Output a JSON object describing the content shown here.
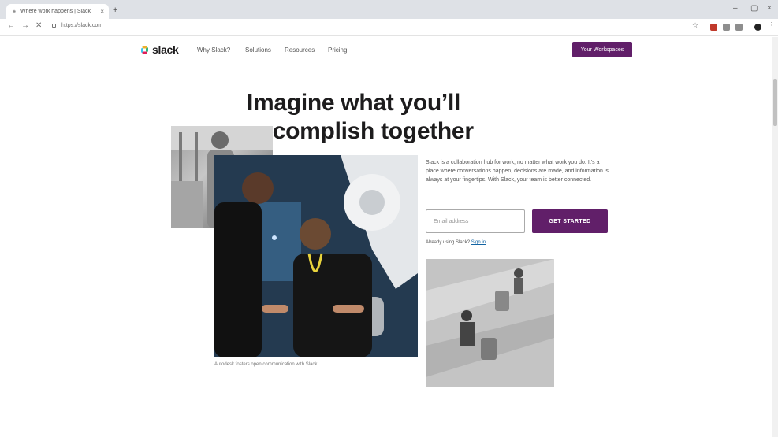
{
  "browser": {
    "tab_title": "Where work happens | Slack",
    "tab_close": "×",
    "new_tab": "+",
    "url": "https://slack.com",
    "window_controls": {
      "minimize": "–",
      "maximize": "▢",
      "close": "×"
    },
    "nav": {
      "back": "←",
      "forward": "→",
      "stop": "✕"
    },
    "bookmark_star": "☆",
    "menu": "⋮"
  },
  "site": {
    "logo_text": "slack",
    "nav_links": [
      "Why Slack?",
      "Solutions",
      "Resources",
      "Pricing"
    ],
    "workspaces_button": "Your Workspaces",
    "brand_color": "#611f69"
  },
  "hero": {
    "headline": "Imagine what you’ll accomplish together",
    "description": "Slack is a collaboration hub for work, no matter what work you do. It’s a place where conversations happen, decisions are made, and information is always at your fingertips. With Slack, your team is better connected.",
    "email_placeholder": "Email address",
    "get_started": "GET STARTED",
    "already_using": "Already using Slack?",
    "sign_in": "Sign in",
    "caption": "Autodesk fosters open communication with Slack"
  }
}
